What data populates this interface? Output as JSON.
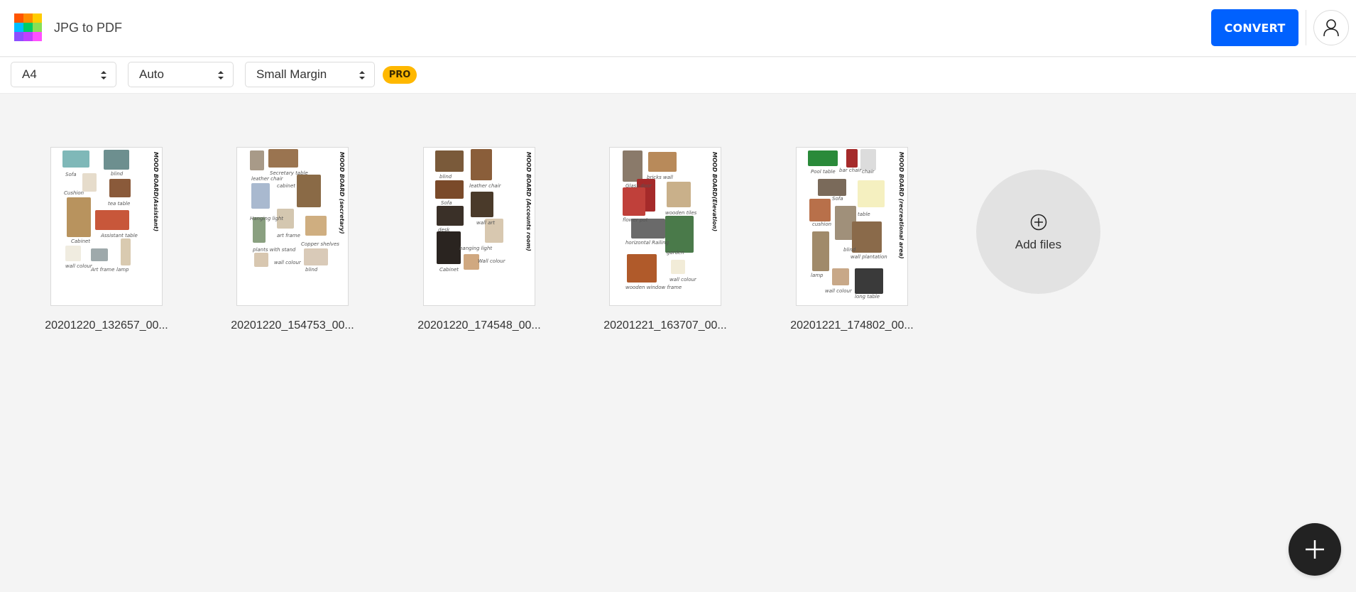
{
  "header": {
    "app_title": "JPG to PDF",
    "logo_colors": [
      "#FF5500",
      "#FF8C00",
      "#FFCC00",
      "#00BFFF",
      "#00CC66",
      "#88E055",
      "#8C4FFF",
      "#C040FF",
      "#FF50FF"
    ],
    "convert_label": "CONVERT",
    "user_icon": "user-icon"
  },
  "colors": {
    "accent": "#0061FE",
    "pro": "#FFB800",
    "fab": "#222222",
    "add_circle": "#E2E2E2",
    "background": "#F4F4F4"
  },
  "toolbar": {
    "page_size": {
      "value": "A4"
    },
    "orientation": {
      "value": "Auto"
    },
    "margin": {
      "value": "Small Margin"
    },
    "pro_badge": "PRO"
  },
  "files": [
    {
      "name": "20201220_132657_00...",
      "title": "MOOD BOARD(Assistant)",
      "labels": [
        "Sofa",
        "blind",
        "Cushion",
        "tea table",
        "Cabinet",
        "Assistant table",
        "wall colour",
        "Art frame",
        "lamp"
      ]
    },
    {
      "name": "20201220_154753_00...",
      "title": "MOOD BOARD (secretary)",
      "labels": [
        "leather chair",
        "Secretary table",
        "cabinet",
        "Hanging light",
        "art frame",
        "Copper shelves",
        "plants with stand",
        "wall colour",
        "blind"
      ]
    },
    {
      "name": "20201220_174548_00...",
      "title": "MOOD BOARD (Accounts room)",
      "labels": [
        "blind",
        "leather chair",
        "Sofa",
        "wall art",
        "desk",
        "hanging light",
        "Wall colour",
        "Cabinet"
      ]
    },
    {
      "name": "20201221_163707_00...",
      "title": "MOOD BOARD(Elevation)",
      "labels": [
        "Glass door",
        "bricks wall",
        "wooden tiles",
        "flower pot",
        "horizontal Railing",
        "garden",
        "wooden window frame",
        "wall colour"
      ]
    },
    {
      "name": "20201221_174802_00...",
      "title": "MOOD BOARD (recreational area)",
      "labels": [
        "Pool table",
        "bar chair",
        "chair",
        "Sofa",
        "table",
        "cushion",
        "blind",
        "wall plantation",
        "lamp",
        "wall colour",
        "long table"
      ]
    }
  ],
  "add_files": {
    "label": "Add files"
  },
  "fab": {
    "icon": "plus-icon"
  }
}
